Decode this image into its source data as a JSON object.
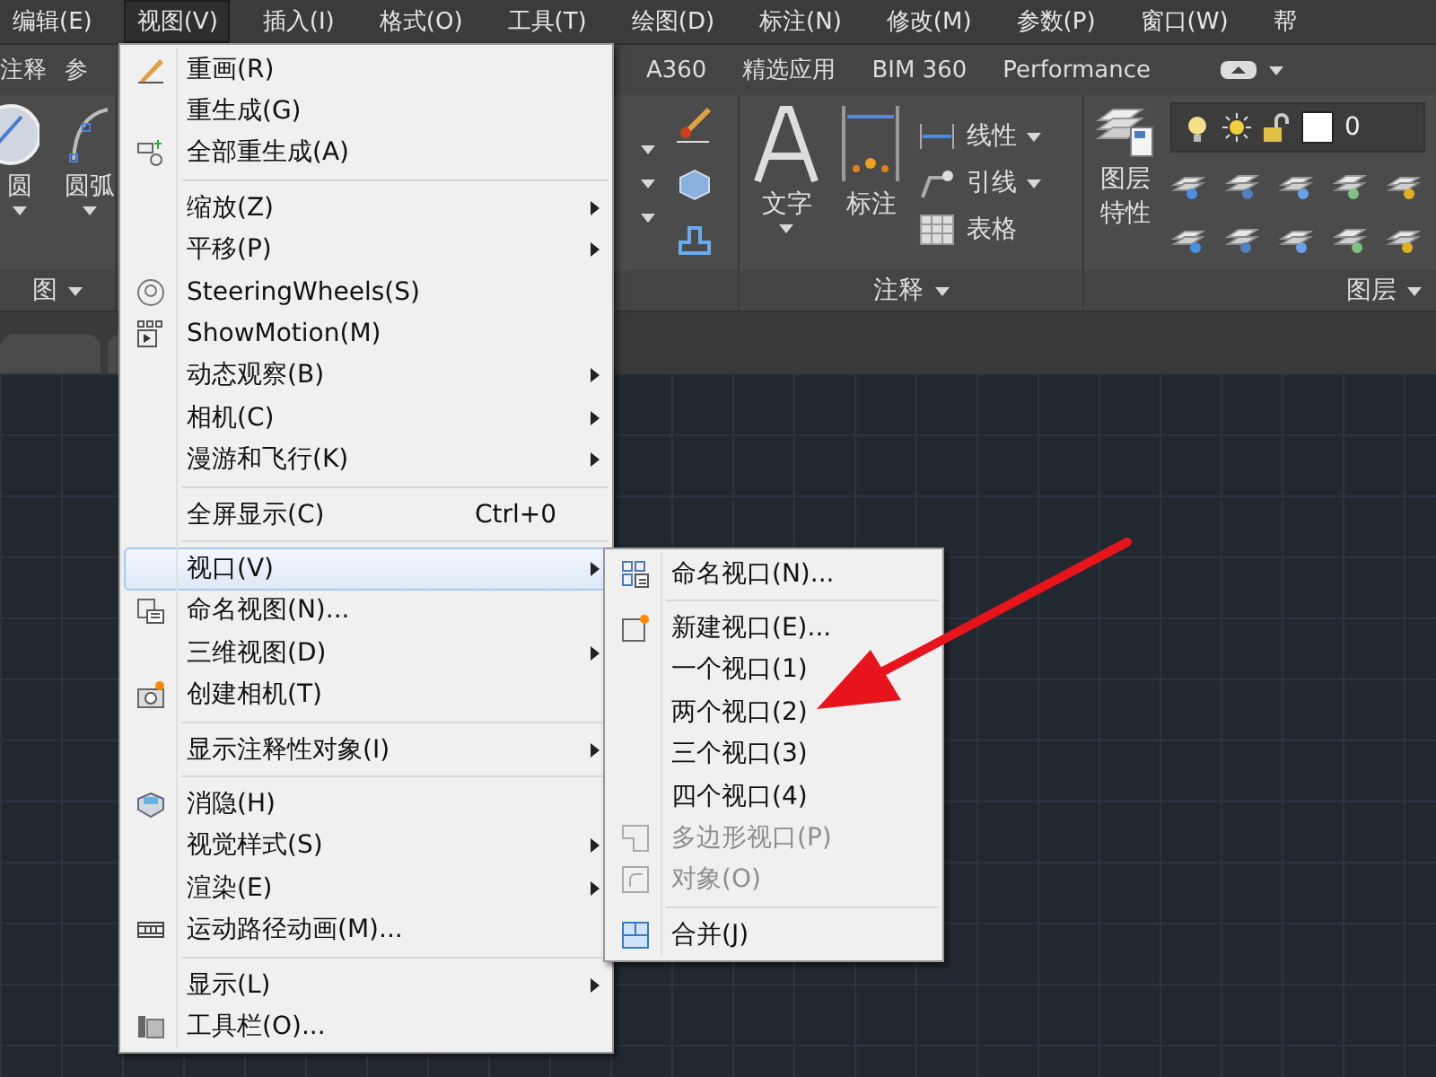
{
  "menubar": [
    {
      "label": "编辑(E)",
      "selected": false
    },
    {
      "label": "视图(V)",
      "selected": true
    },
    {
      "label": "插入(I)",
      "selected": false
    },
    {
      "label": "格式(O)",
      "selected": false
    },
    {
      "label": "工具(T)",
      "selected": false
    },
    {
      "label": "绘图(D)",
      "selected": false
    },
    {
      "label": "标注(N)",
      "selected": false
    },
    {
      "label": "修改(M)",
      "selected": false
    },
    {
      "label": "参数(P)",
      "selected": false
    },
    {
      "label": "窗口(W)",
      "selected": false
    },
    {
      "label": "帮",
      "selected": false
    }
  ],
  "ribbon_tabs": {
    "left": [
      "注释",
      "参"
    ],
    "right": [
      "A360",
      "精选应用",
      "BIM 360",
      "Performance"
    ]
  },
  "ribbon": {
    "draw_panel": {
      "tools": [
        {
          "label": "圆",
          "dropdown": true
        },
        {
          "label": "圆弧",
          "dropdown": true
        }
      ],
      "title": "图"
    },
    "annotation_panel": {
      "large_tools": [
        {
          "label": "文字",
          "dropdown": true
        },
        {
          "label": "标注",
          "dropdown": false
        }
      ],
      "small_tools": [
        {
          "label": "线性",
          "dropdown": true
        },
        {
          "label": "引线",
          "dropdown": true
        },
        {
          "label": "表格",
          "dropdown": false
        }
      ],
      "title": "注释"
    },
    "layers_panel": {
      "large_tool": "图层特性",
      "current_layer": "0",
      "title": "图层"
    }
  },
  "view_menu": {
    "groups": [
      [
        {
          "label": "重画(R)",
          "submenu": false,
          "selected": false
        },
        {
          "label": "重生成(G)",
          "submenu": false,
          "selected": false
        },
        {
          "label": "全部重生成(A)",
          "submenu": false,
          "selected": false
        }
      ],
      [
        {
          "label": "缩放(Z)",
          "submenu": true,
          "selected": false
        },
        {
          "label": "平移(P)",
          "submenu": true,
          "selected": false
        },
        {
          "label": "SteeringWheels(S)",
          "submenu": false,
          "selected": false
        },
        {
          "label": "ShowMotion(M)",
          "submenu": false,
          "selected": false
        },
        {
          "label": "动态观察(B)",
          "submenu": true,
          "selected": false
        },
        {
          "label": "相机(C)",
          "submenu": true,
          "selected": false
        },
        {
          "label": "漫游和飞行(K)",
          "submenu": true,
          "selected": false
        }
      ],
      [
        {
          "label": "全屏显示(C)",
          "shortcut": "Ctrl+0",
          "submenu": false,
          "selected": false
        }
      ],
      [
        {
          "label": "视口(V)",
          "submenu": true,
          "selected": true
        },
        {
          "label": "命名视图(N)...",
          "submenu": false,
          "selected": false
        },
        {
          "label": "三维视图(D)",
          "submenu": true,
          "selected": false
        },
        {
          "label": "创建相机(T)",
          "submenu": false,
          "selected": false
        }
      ],
      [
        {
          "label": "显示注释性对象(I)",
          "submenu": true,
          "selected": false
        }
      ],
      [
        {
          "label": "消隐(H)",
          "submenu": false,
          "selected": false
        },
        {
          "label": "视觉样式(S)",
          "submenu": true,
          "selected": false
        },
        {
          "label": "渲染(E)",
          "submenu": true,
          "selected": false
        },
        {
          "label": "运动路径动画(M)...",
          "submenu": false,
          "selected": false
        }
      ],
      [
        {
          "label": "显示(L)",
          "submenu": true,
          "selected": false
        },
        {
          "label": "工具栏(O)...",
          "submenu": false,
          "selected": false
        }
      ]
    ]
  },
  "viewports_menu": {
    "groups": [
      [
        {
          "label": "命名视口(N)...",
          "disabled": false
        }
      ],
      [
        {
          "label": "新建视口(E)...",
          "disabled": false
        },
        {
          "label": "一个视口(1)",
          "disabled": false
        },
        {
          "label": "两个视口(2)",
          "disabled": false
        },
        {
          "label": "三个视口(3)",
          "disabled": false
        },
        {
          "label": "四个视口(4)",
          "disabled": false
        },
        {
          "label": "多边形视口(P)",
          "disabled": true
        },
        {
          "label": "对象(O)",
          "disabled": true
        }
      ],
      [
        {
          "label": "合并(J)",
          "disabled": false
        }
      ]
    ]
  }
}
